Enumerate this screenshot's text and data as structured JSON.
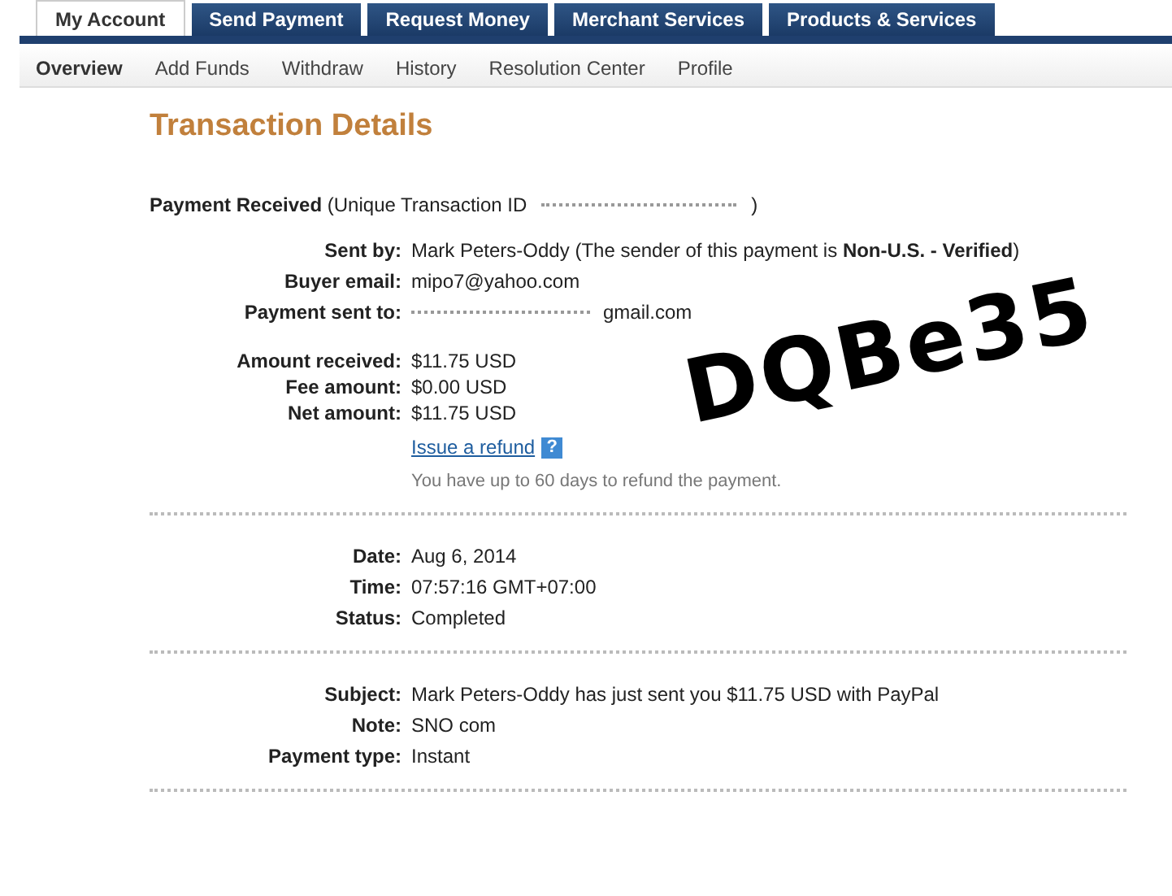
{
  "tabs": [
    {
      "label": "My Account",
      "selected": true
    },
    {
      "label": "Send Payment",
      "selected": false
    },
    {
      "label": "Request Money",
      "selected": false
    },
    {
      "label": "Merchant Services",
      "selected": false
    },
    {
      "label": "Products & Services",
      "selected": false
    }
  ],
  "subnav": [
    {
      "label": "Overview",
      "selected": true
    },
    {
      "label": "Add Funds",
      "selected": false
    },
    {
      "label": "Withdraw",
      "selected": false
    },
    {
      "label": "History",
      "selected": false
    },
    {
      "label": "Resolution Center",
      "selected": false
    },
    {
      "label": "Profile",
      "selected": false
    }
  ],
  "title": "Transaction Details",
  "heading": {
    "label": "Payment Received",
    "detail": "(Unique Transaction ID",
    "end": ")",
    "redacted": true
  },
  "sections": [
    {
      "rows": [
        {
          "label": "Sent by:",
          "value": "Mark Peters-Oddy (The sender of this payment is **Non-U.S. - Verified**)"
        },
        {
          "label": "Buyer email:",
          "value": "mipo7@yahoo.com"
        },
        {
          "label": "Payment sent to:",
          "value": "gmail.com",
          "redacted": true
        }
      ],
      "rows2": [
        {
          "label": "Amount received:",
          "value": "$11.75 USD"
        },
        {
          "label": "Fee amount:",
          "value": "$0.00 USD"
        },
        {
          "label": "Net amount:",
          "value": "$11.75 USD"
        }
      ],
      "link": "Issue a refund",
      "help": "?",
      "note": "You have up to 60 days to refund the payment."
    },
    {
      "rows": [
        {
          "label": "Date:",
          "value": "Aug 6, 2014"
        },
        {
          "label": "Time:",
          "value": "07:57:16 GMT+07:00"
        },
        {
          "label": "Status:",
          "value": "Completed"
        }
      ]
    },
    {
      "rows": [
        {
          "label": "Subject:",
          "value": "Mark Peters-Oddy has just sent you $11.75 USD with PayPal"
        },
        {
          "label": "Note:",
          "value": "SNO com"
        },
        {
          "label": "Payment type:",
          "value": "Instant"
        }
      ]
    }
  ],
  "handwriting": "DQBe35"
}
